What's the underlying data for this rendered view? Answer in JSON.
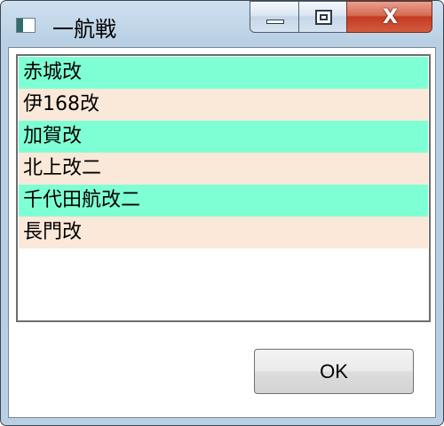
{
  "window": {
    "title": "一航戦",
    "icon": "app-window-icon",
    "close_glyph": "X"
  },
  "list": {
    "colors": {
      "odd": "#7fffd4",
      "even": "#fae8d8"
    },
    "items": [
      {
        "label": "赤城改"
      },
      {
        "label": "伊168改"
      },
      {
        "label": "加賀改"
      },
      {
        "label": "北上改二"
      },
      {
        "label": "千代田航改二"
      },
      {
        "label": "長門改"
      }
    ]
  },
  "buttons": {
    "ok_label": "OK"
  }
}
